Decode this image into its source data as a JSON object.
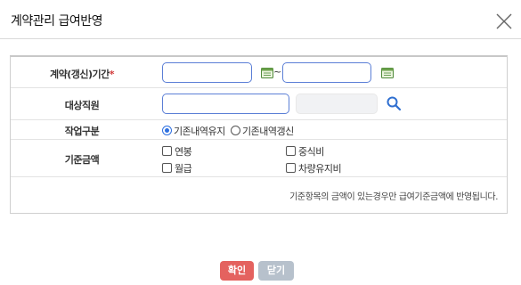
{
  "dialog": {
    "title": "계약관리 급여반영",
    "close_icon": "close-icon"
  },
  "form": {
    "contract_period": {
      "label": "계약(갱신)기간",
      "required_mark": "*",
      "start_value": "",
      "end_value": "",
      "separator": "~",
      "calendar_icon": "calendar-icon"
    },
    "target_employee": {
      "label": "대상직원",
      "value": "",
      "readonly_value": "",
      "search_icon": "search-icon"
    },
    "work_type": {
      "label": "작업구분",
      "options": [
        {
          "label": "기존내역유지",
          "selected": true
        },
        {
          "label": "기존내역갱신",
          "selected": false
        }
      ]
    },
    "base_amount": {
      "label": "기준금액",
      "options": [
        {
          "label": "연봉",
          "checked": false
        },
        {
          "label": "중식비",
          "checked": false
        },
        {
          "label": "월급",
          "checked": false
        },
        {
          "label": "차량유지비",
          "checked": false
        }
      ]
    },
    "note": "기준항목의 금액이 있는경우만 급여기준금액에 반영됩니다."
  },
  "buttons": {
    "confirm": "확인",
    "close": "닫기"
  },
  "colors": {
    "input_border": "#5b7fd6",
    "confirm_button": "#e4625f",
    "close_button": "#b7c1cc",
    "radio_accent": "#2d6fe0",
    "search_icon": "#2f6fd0",
    "calendar_icon": "#4f8a3a"
  }
}
